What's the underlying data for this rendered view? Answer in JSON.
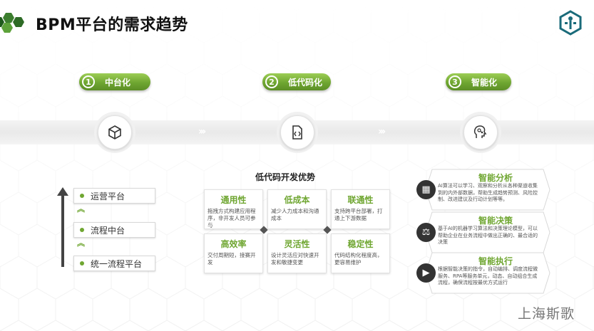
{
  "title": "BPM平台的需求趋势",
  "colors": {
    "accent_green": "#6fa631",
    "band": "#ececec",
    "dark": "#444444",
    "logo_teal": "#1a6b7a"
  },
  "stages": [
    {
      "num": "1",
      "label": "中台化",
      "icon": "cube-icon"
    },
    {
      "num": "2",
      "label": "低代码化",
      "icon": "code-file-icon"
    },
    {
      "num": "3",
      "label": "智能化",
      "icon": "ai-head-icon"
    }
  ],
  "platform_stack": [
    "运营平台",
    "流程中台",
    "统一流程平台"
  ],
  "lowcode": {
    "title": "低代码开发优势",
    "cards": [
      {
        "title": "通用性",
        "body": "拖拽方式构建应用程序，非开发人员可参与"
      },
      {
        "title": "低成本",
        "body": "减少人力成本和沟通成本"
      },
      {
        "title": "联通性",
        "body": "支持跨平台部署，打通上下游数据"
      },
      {
        "title": "高效率",
        "body": "交付周期短，接赛开发"
      },
      {
        "title": "灵活性",
        "body": "设计灵活应对快速开发和敏捷变更"
      },
      {
        "title": "稳定性",
        "body": "代码结构化程度高，更容易维护"
      }
    ]
  },
  "intelligence": [
    {
      "title": "智能分析",
      "body": "AI算法可以学习、观察和分析从各种渠道收集到的内外部数据，帮助生成趋势预测、风险控制、改进建议及行动计划等等。",
      "icon": "analysis-icon"
    },
    {
      "title": "智能决策",
      "body": "基于AI的机器学习算法和决策理论模型，可以帮助企业在业务流程中做出正确的、最合适的决策",
      "icon": "gavel-icon"
    },
    {
      "title": "智能执行",
      "body": "根据智能决策的指令，自动编排、调度流程微服务、RPA等服务单元，动态、自动组合生成流程，确保流程按最优方式运行",
      "icon": "execute-icon"
    }
  ],
  "watermark": "上海斯歌"
}
